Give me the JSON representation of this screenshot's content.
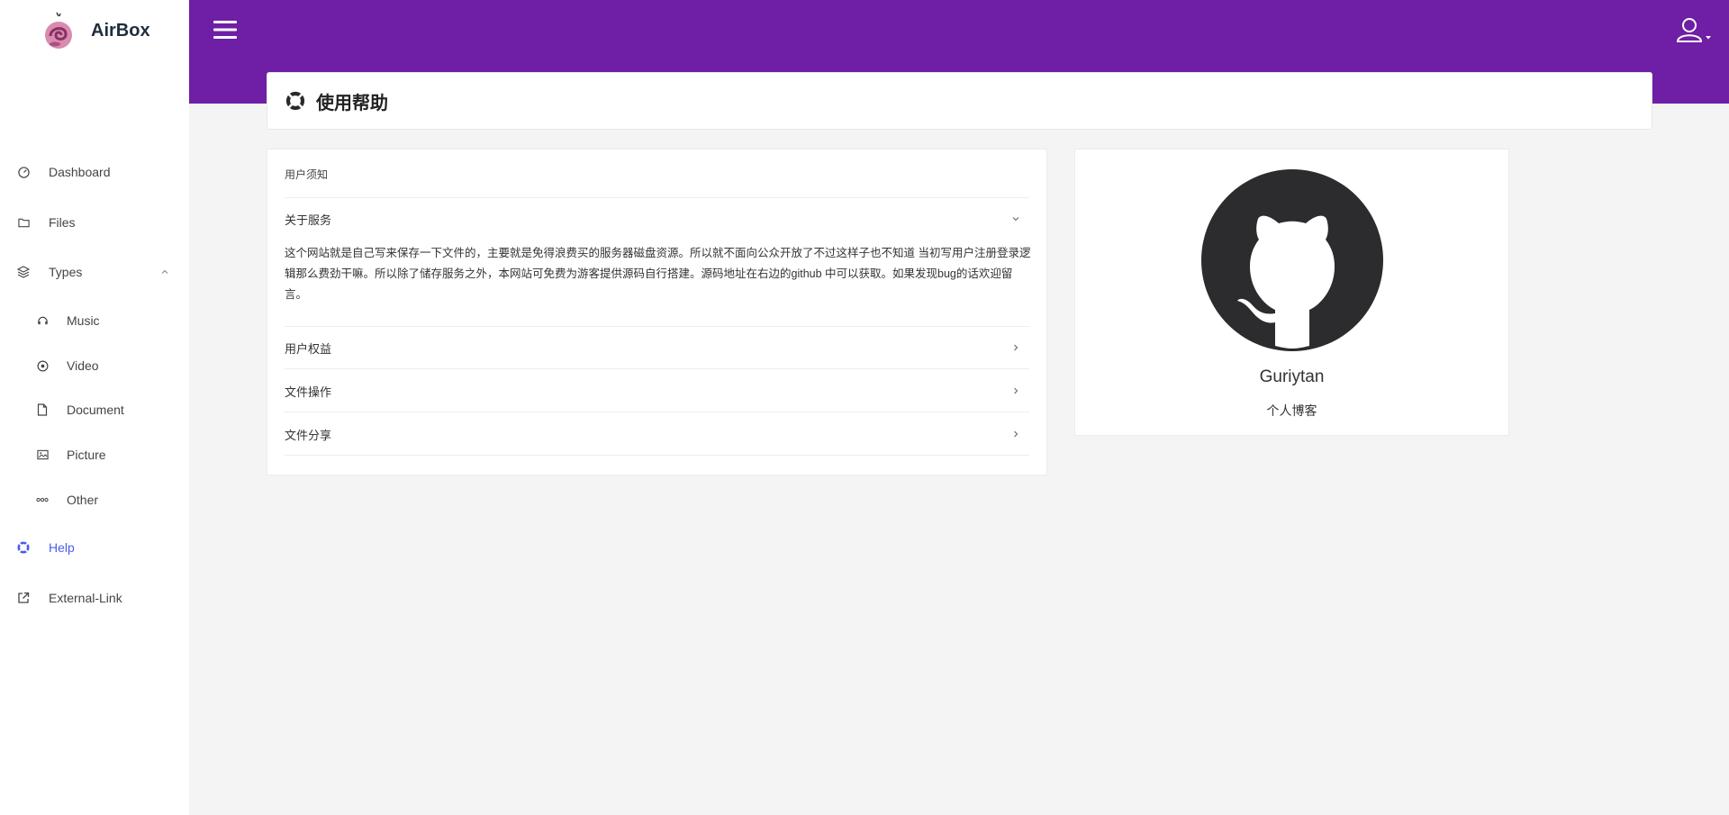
{
  "brand": {
    "name": "AirBox"
  },
  "sidebar": {
    "items": [
      {
        "label": "Dashboard",
        "icon": "dashboard-icon"
      },
      {
        "label": "Files",
        "icon": "folder-icon"
      },
      {
        "label": "Types",
        "icon": "layers-icon",
        "expanded": true
      },
      {
        "label": "Music",
        "icon": "headphones-icon"
      },
      {
        "label": "Video",
        "icon": "play-circle-icon"
      },
      {
        "label": "Document",
        "icon": "document-icon"
      },
      {
        "label": "Picture",
        "icon": "picture-icon"
      },
      {
        "label": "Other",
        "icon": "ellipsis-icon"
      },
      {
        "label": "Help",
        "icon": "help-icon",
        "active": true
      },
      {
        "label": "External-Link",
        "icon": "external-link-icon"
      }
    ]
  },
  "page": {
    "title": "使用帮助"
  },
  "help": {
    "header": "用户须知",
    "sections": [
      {
        "title": "关于服务",
        "expanded": true,
        "content": "这个网站就是自己写来保存一下文件的，主要就是免得浪费买的服务器磁盘资源。所以就不面向公众开放了不过这样子也不知道 当初写用户注册登录逻辑那么费劲干嘛。所以除了储存服务之外，本网站可免费为游客提供源码自行搭建。源码地址在右边的github 中可以获取。如果发现bug的话欢迎留言。"
      },
      {
        "title": "用户权益"
      },
      {
        "title": "文件操作"
      },
      {
        "title": "文件分享"
      }
    ]
  },
  "profile": {
    "name": "Guriytan",
    "description": "个人博客"
  },
  "colors": {
    "header": "#6e1fa5",
    "active": "#4a5cf0",
    "github": "#2c2c2e"
  }
}
